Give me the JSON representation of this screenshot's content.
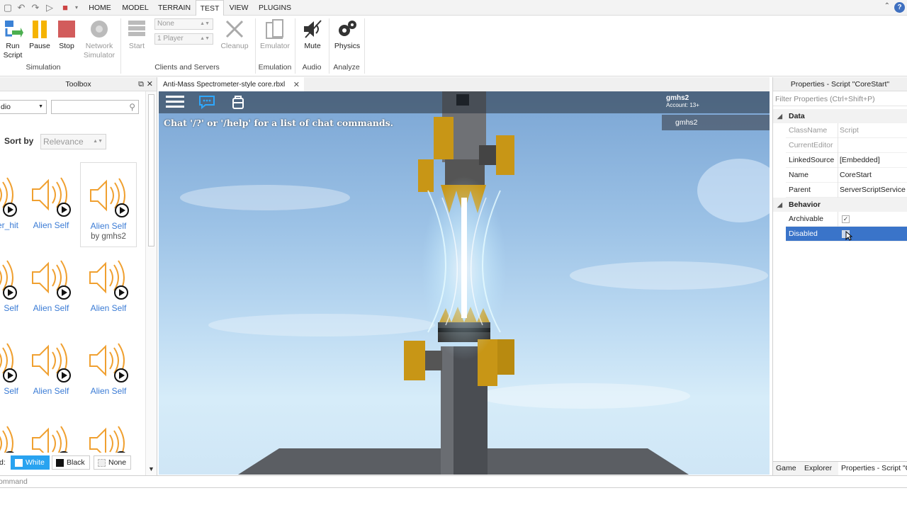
{
  "menubar": {
    "tabs": [
      "HOME",
      "MODEL",
      "TERRAIN",
      "TEST",
      "VIEW",
      "PLUGINS"
    ],
    "active_tab": "TEST"
  },
  "ribbon": {
    "run_script": "Run\nScript",
    "pause": "Pause",
    "stop": "Stop",
    "network_simulator": "Network\nSimulator",
    "simulation_label": "Simulation",
    "start": "Start",
    "clients_select": "None",
    "players_select": "1 Player",
    "cleanup": "Cleanup",
    "clients_servers_label": "Clients and Servers",
    "emulator": "Emulator",
    "emulation_label": "Emulation",
    "mute": "Mute",
    "audio_label": "Audio",
    "physics": "Physics",
    "analyze_label": "Analyze"
  },
  "toolbox": {
    "title": "Toolbox",
    "category": "dio",
    "search_placeholder": "",
    "sort_label": "Sort by",
    "sort_value": "Relevance",
    "assets": [
      {
        "name": "per_hit",
        "by": ""
      },
      {
        "name": "Alien Self",
        "by": ""
      },
      {
        "name": "Alien Self",
        "by": "by gmhs2"
      },
      {
        "name": "Self",
        "by": ""
      },
      {
        "name": "Alien Self",
        "by": ""
      },
      {
        "name": "Alien Self",
        "by": ""
      },
      {
        "name": "Self",
        "by": ""
      },
      {
        "name": "Alien Self",
        "by": ""
      },
      {
        "name": "Alien Self",
        "by": ""
      }
    ],
    "bg_label": "d:",
    "bg_white": "White",
    "bg_black": "Black",
    "bg_none": "None"
  },
  "document": {
    "tab_title": "Anti-Mass Spectrometer-style core.rbxl"
  },
  "viewport": {
    "chat_hint": "Chat '/?' or '/help' for a list of chat commands.",
    "player_name": "gmhs2",
    "account": "Account: 13+",
    "player_list_name": "gmhs2"
  },
  "properties": {
    "title": "Properties - Script \"CoreStart\"",
    "filter_placeholder": "Filter Properties (Ctrl+Shift+P)",
    "cat_data": "Data",
    "cat_behavior": "Behavior",
    "rows": [
      {
        "name": "ClassName",
        "value": "Script"
      },
      {
        "name": "CurrentEditor",
        "value": ""
      },
      {
        "name": "LinkedSource",
        "value": "[Embedded]"
      },
      {
        "name": "Name",
        "value": "CoreStart"
      },
      {
        "name": "Parent",
        "value": "ServerScriptService"
      },
      {
        "name": "Archivable",
        "value": "✓"
      },
      {
        "name": "Disabled",
        "value": ""
      }
    ],
    "tabs": [
      "Game",
      "Explorer",
      "Properties - Script \"C"
    ]
  },
  "commandbar": {
    "placeholder": "ommand"
  },
  "colors": {
    "accent_blue": "#3a74c9",
    "speaker_orange": "#f0a030",
    "link_blue": "#3a7bd5"
  }
}
